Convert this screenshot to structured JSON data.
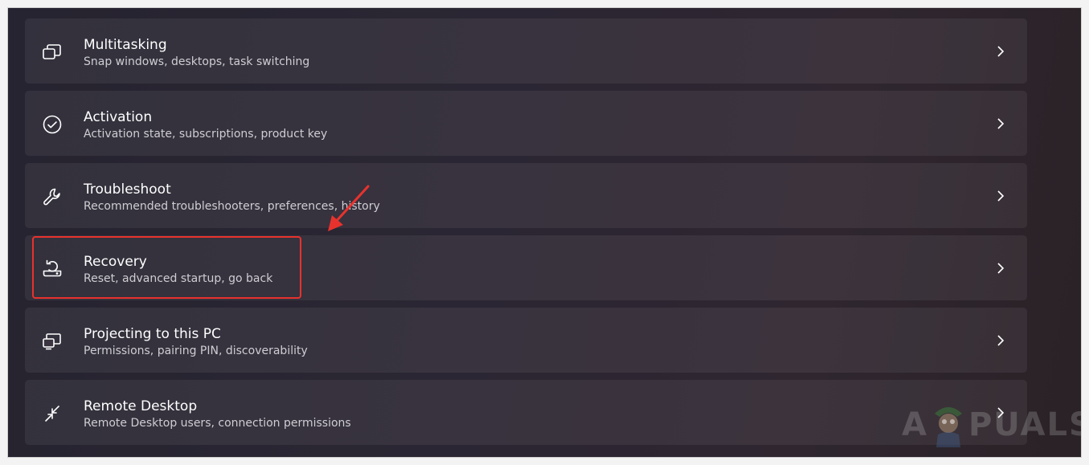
{
  "settings_list": [
    {
      "title": "Multitasking",
      "subtitle": "Snap windows, desktops, task switching",
      "icon": "multitasking-icon"
    },
    {
      "title": "Activation",
      "subtitle": "Activation state, subscriptions, product key",
      "icon": "activation-check-icon"
    },
    {
      "title": "Troubleshoot",
      "subtitle": "Recommended troubleshooters, preferences, history",
      "icon": "wrench-icon"
    },
    {
      "title": "Recovery",
      "subtitle": "Reset, advanced startup, go back",
      "icon": "recovery-icon"
    },
    {
      "title": "Projecting to this PC",
      "subtitle": "Permissions, pairing PIN, discoverability",
      "icon": "projecting-icon"
    },
    {
      "title": "Remote Desktop",
      "subtitle": "Remote Desktop users, connection permissions",
      "icon": "remote-desktop-icon"
    }
  ],
  "annotation": {
    "highlight_color": "#e8322d",
    "target": "Recovery"
  },
  "watermark": {
    "text_left": "A",
    "text_right": "PUALS"
  },
  "colors": {
    "background": "#2b2633",
    "card": "#37323e",
    "text": "#ffffff",
    "subtext": "#cfcdd3",
    "accent": "#e8322d"
  }
}
